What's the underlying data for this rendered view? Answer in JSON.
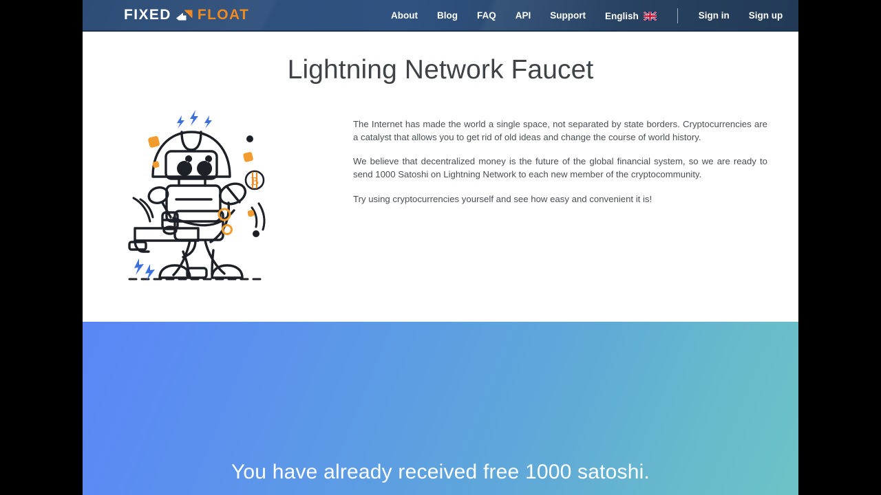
{
  "header": {
    "logo": {
      "word_primary": "FIXED",
      "word_secondary": "FLOAT",
      "mark_icon": "arrow-exchange-icon"
    },
    "nav_items": [
      {
        "label": "About",
        "name": "nav-link-about"
      },
      {
        "label": "Blog",
        "name": "nav-link-blog"
      },
      {
        "label": "FAQ",
        "name": "nav-link-faq"
      },
      {
        "label": "API",
        "name": "nav-link-api"
      },
      {
        "label": "Support",
        "name": "nav-link-support"
      }
    ],
    "language": {
      "label": "English",
      "flag_icon": "uk-flag-icon"
    },
    "auth": {
      "sign_in_label": "Sign in",
      "sign_up_label": "Sign up"
    }
  },
  "main": {
    "title": "Lightning Network Faucet",
    "illustration": {
      "name": "robot-faucet-illustration",
      "accent_orange": "#f29b2e",
      "accent_blue": "#3b6fe0",
      "line_color": "#1d2026",
      "bitcoin_icon": "bitcoin-badge-icon"
    },
    "paragraphs": [
      "The Internet has made the world a single space, not separated by state borders. Cryptocurrencies are a catalyst that allows you to get rid of old ideas and change the course of world history.",
      "We believe that decentralized money is the future of the global financial system, so we are ready to send 1000 Satoshi on Lightning Network to each new member of the cryptocommunity.",
      "Try using cryptocurrencies yourself and see how easy and convenient it is!"
    ]
  },
  "banner": {
    "message": "You have already received free 1000 satoshi.",
    "gradient_start": "#5b86f6",
    "gradient_end": "#6cc3c6"
  },
  "theme": {
    "header_bg": "#2d4d77",
    "logo_orange": "#ef8a22",
    "title_color": "#3f4246",
    "body_text_color": "#4a4e54"
  }
}
